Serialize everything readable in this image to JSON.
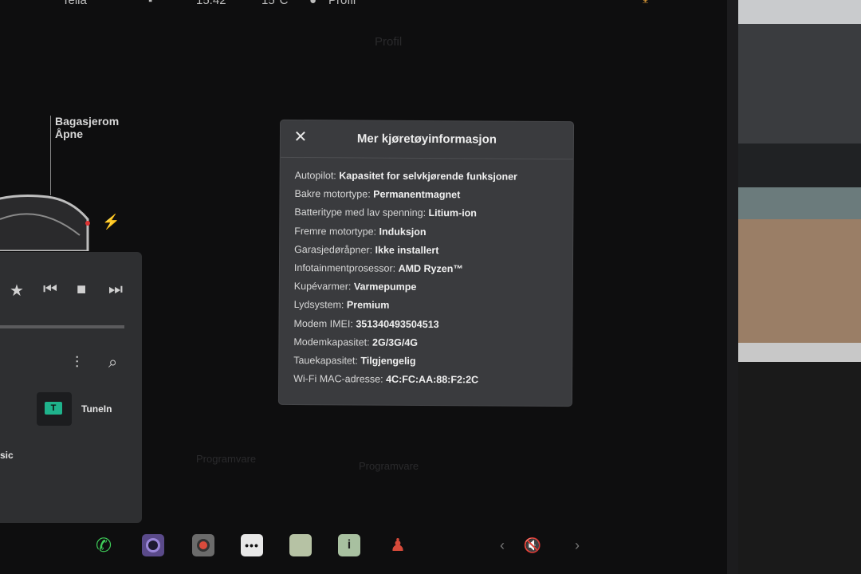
{
  "status_bar": {
    "connectivity": "Telia",
    "time": "15:42",
    "temperature": "15°C",
    "profile": "Profil",
    "icons": [
      "download-icon",
      "sos-icon"
    ]
  },
  "trunk": {
    "label_line1": "Bagasjerom",
    "label_line2": "Åpne"
  },
  "media": {
    "source_tunein": "TuneIn",
    "source_partial": "sic",
    "controls": [
      "favorite-icon",
      "previous-icon",
      "stop-icon",
      "next-icon"
    ]
  },
  "background_ghosts": {
    "header": "Profil",
    "programvare": "Programvare",
    "programvare_right": "Programvare"
  },
  "modal": {
    "title": "Mer kjøretøyinformasjon",
    "close_icon": "close-icon",
    "rows": [
      {
        "key": "Autopilot:",
        "value": "Kapasitet for selvkjørende funksjoner"
      },
      {
        "key": "Bakre motortype:",
        "value": "Permanentmagnet"
      },
      {
        "key": "Batteritype med lav spenning:",
        "value": "Litium-ion"
      },
      {
        "key": "Fremre motortype:",
        "value": "Induksjon"
      },
      {
        "key": "Garasjedøråpner:",
        "value": "Ikke installert"
      },
      {
        "key": "Infotainmentprosessor:",
        "value": "AMD Ryzen™"
      },
      {
        "key": "Kupévarmer:",
        "value": "Varmepumpe"
      },
      {
        "key": "Lydsystem:",
        "value": "Premium"
      },
      {
        "key": "Modem IMEI:",
        "value": "351340493504513"
      },
      {
        "key": "Modemkapasitet:",
        "value": "2G/3G/4G"
      },
      {
        "key": "Tauekapasitet:",
        "value": "Tilgjengelig"
      },
      {
        "key": "Wi-Fi MAC-adresse:",
        "value": "4C:FC:AA:88:F2:2C"
      }
    ]
  },
  "dock": {
    "icons": [
      "phone-icon",
      "camera-icon",
      "dashcam-icon",
      "more-icon",
      "calculator-icon",
      "manual-icon",
      "joystick-icon"
    ],
    "volume_icon": "volume-muted-icon",
    "prev_icon": "chevron-left-icon",
    "next_icon": "chevron-right-icon"
  }
}
